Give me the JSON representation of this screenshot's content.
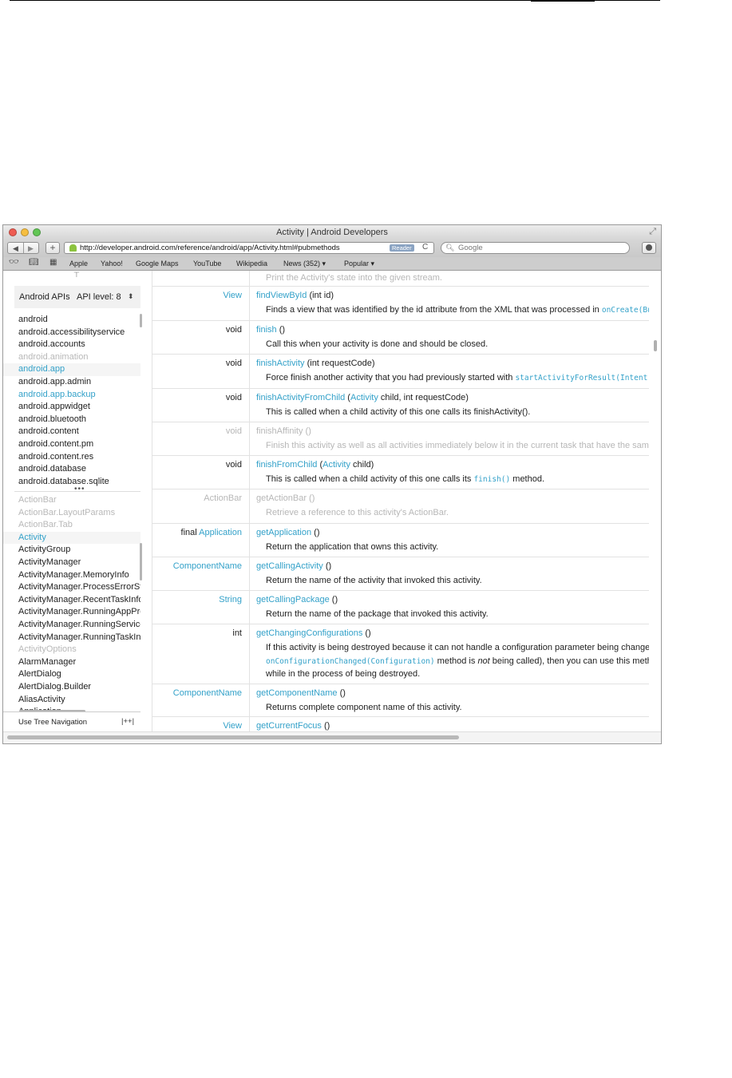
{
  "window": {
    "title": "Activity | Android Developers"
  },
  "toolbar": {
    "back_icon": "back-arrow-icon",
    "forward_icon": "forward-arrow-icon",
    "add_label": "+",
    "url": "http://developer.android.com/reference/android/app/Activity.html#pubmethods",
    "reader_label": "Reader",
    "reload_glyph": "C",
    "search_placeholder": "Google"
  },
  "bookmarks": [
    "Apple",
    "Yahoo!",
    "Google Maps",
    "YouTube",
    "Wikipedia",
    "News (352) ▾",
    "Popular ▾"
  ],
  "sidebar": {
    "api_title": "Android APIs",
    "api_level": "API level: 8",
    "api_arrows": "⬍",
    "packages": [
      {
        "name": "android",
        "state": "normal"
      },
      {
        "name": "android.accessibilityservice",
        "state": "normal"
      },
      {
        "name": "android.accounts",
        "state": "normal"
      },
      {
        "name": "android.animation",
        "state": "dim"
      },
      {
        "name": "android.app",
        "state": "selected"
      },
      {
        "name": "android.app.admin",
        "state": "normal"
      },
      {
        "name": "android.app.backup",
        "state": "link"
      },
      {
        "name": "android.appwidget",
        "state": "normal"
      },
      {
        "name": "android.bluetooth",
        "state": "normal"
      },
      {
        "name": "android.content",
        "state": "normal"
      },
      {
        "name": "android.content.pm",
        "state": "normal"
      },
      {
        "name": "android.content.res",
        "state": "normal"
      },
      {
        "name": "android.database",
        "state": "normal"
      },
      {
        "name": "android.database.sqlite",
        "state": "normal"
      }
    ],
    "classes": [
      {
        "name": "ActionBar",
        "state": "dim"
      },
      {
        "name": "ActionBar.LayoutParams",
        "state": "dim"
      },
      {
        "name": "ActionBar.Tab",
        "state": "dim"
      },
      {
        "name": "Activity",
        "state": "selected"
      },
      {
        "name": "ActivityGroup",
        "state": "normal"
      },
      {
        "name": "ActivityManager",
        "state": "normal"
      },
      {
        "name": "ActivityManager.MemoryInfo",
        "state": "normal"
      },
      {
        "name": "ActivityManager.ProcessErrorStateInfo",
        "state": "normal"
      },
      {
        "name": "ActivityManager.RecentTaskInfo",
        "state": "normal"
      },
      {
        "name": "ActivityManager.RunningAppProcessInfo",
        "state": "normal"
      },
      {
        "name": "ActivityManager.RunningServiceInfo",
        "state": "normal"
      },
      {
        "name": "ActivityManager.RunningTaskInfo",
        "state": "normal"
      },
      {
        "name": "ActivityOptions",
        "state": "dim"
      },
      {
        "name": "AlarmManager",
        "state": "normal"
      },
      {
        "name": "AlertDialog",
        "state": "normal"
      },
      {
        "name": "AlertDialog.Builder",
        "state": "normal"
      },
      {
        "name": "AliasActivity",
        "state": "normal"
      },
      {
        "name": "Application",
        "state": "normal"
      }
    ],
    "tree_nav_label": "Use Tree Navigation",
    "tree_nav_toggle": "|++|"
  },
  "methods": [
    {
      "dim": true,
      "ret": [],
      "sig": [],
      "desc": [
        [
          {
            "t": "Print the Activity's state into the given stream."
          }
        ]
      ]
    },
    {
      "dim": false,
      "ret": [
        {
          "t": "View",
          "c": "lnk"
        }
      ],
      "sig": [
        {
          "t": "findViewById",
          "c": "lnk"
        },
        {
          "t": " (int id)"
        }
      ],
      "desc": [
        [
          {
            "t": "Finds a view that was identified by the id attribute from the XML that was processed in "
          },
          {
            "t": "onCreate(Bundle)",
            "c": "code"
          }
        ]
      ]
    },
    {
      "dim": false,
      "ret": [
        {
          "t": "void"
        }
      ],
      "sig": [
        {
          "t": "finish",
          "c": "lnk"
        },
        {
          "t": " ()"
        }
      ],
      "desc": [
        [
          {
            "t": "Call this when your activity is done and should be closed."
          }
        ]
      ]
    },
    {
      "dim": false,
      "ret": [
        {
          "t": "void"
        }
      ],
      "sig": [
        {
          "t": "finishActivity",
          "c": "lnk"
        },
        {
          "t": " (int requestCode)"
        }
      ],
      "desc": [
        [
          {
            "t": "Force finish another activity that you had previously started with "
          },
          {
            "t": "startActivityForResult(Intent, int)",
            "c": "code"
          }
        ]
      ]
    },
    {
      "dim": false,
      "ret": [
        {
          "t": "void"
        }
      ],
      "sig": [
        {
          "t": "finishActivityFromChild",
          "c": "lnk"
        },
        {
          "t": " ("
        },
        {
          "t": "Activity",
          "c": "lnk"
        },
        {
          "t": " child, int requestCode)"
        }
      ],
      "desc": [
        [
          {
            "t": "This is called when a child activity of this one calls its finishActivity()."
          }
        ]
      ]
    },
    {
      "dim": true,
      "ret": [
        {
          "t": "void"
        }
      ],
      "sig": [
        {
          "t": "finishAffinity",
          "c": "lnk"
        },
        {
          "t": " ()"
        }
      ],
      "desc": [
        [
          {
            "t": "Finish this activity as well as all activities immediately below it in the current task that have the same affinity."
          }
        ]
      ]
    },
    {
      "dim": false,
      "ret": [
        {
          "t": "void"
        }
      ],
      "sig": [
        {
          "t": "finishFromChild",
          "c": "lnk"
        },
        {
          "t": " ("
        },
        {
          "t": "Activity",
          "c": "lnk"
        },
        {
          "t": " child)"
        }
      ],
      "desc": [
        [
          {
            "t": "This is called when a child activity of this one calls its "
          },
          {
            "t": "finish()",
            "c": "code"
          },
          {
            "t": " method."
          }
        ]
      ]
    },
    {
      "dim": true,
      "ret": [
        {
          "t": "ActionBar",
          "c": "lnk"
        }
      ],
      "sig": [
        {
          "t": "getActionBar",
          "c": "lnk"
        },
        {
          "t": " ()"
        }
      ],
      "desc": [
        [
          {
            "t": "Retrieve a reference to this activity's ActionBar."
          }
        ]
      ]
    },
    {
      "dim": false,
      "ret": [
        {
          "t": "final "
        },
        {
          "t": "Application",
          "c": "lnk"
        }
      ],
      "sig": [
        {
          "t": "getApplication",
          "c": "lnk"
        },
        {
          "t": " ()"
        }
      ],
      "desc": [
        [
          {
            "t": "Return the application that owns this activity."
          }
        ]
      ]
    },
    {
      "dim": false,
      "ret": [
        {
          "t": "ComponentName",
          "c": "lnk"
        }
      ],
      "sig": [
        {
          "t": "getCallingActivity",
          "c": "lnk"
        },
        {
          "t": " ()"
        }
      ],
      "desc": [
        [
          {
            "t": "Return the name of the activity that invoked this activity."
          }
        ]
      ]
    },
    {
      "dim": false,
      "ret": [
        {
          "t": "String",
          "c": "lnk"
        }
      ],
      "sig": [
        {
          "t": "getCallingPackage",
          "c": "lnk"
        },
        {
          "t": " ()"
        }
      ],
      "desc": [
        [
          {
            "t": "Return the name of the package that invoked this activity."
          }
        ]
      ]
    },
    {
      "dim": false,
      "ret": [
        {
          "t": "int"
        }
      ],
      "sig": [
        {
          "t": "getChangingConfigurations",
          "c": "lnk"
        },
        {
          "t": " ()"
        }
      ],
      "desc": [
        [
          {
            "t": "If this activity is being destroyed because it can not handle a configuration parameter being changed (and thus its"
          }
        ],
        [
          {
            "t": "onConfigurationChanged(Configuration)",
            "c": "code"
          },
          {
            "t": " method is "
          },
          {
            "t": "not",
            "c": "em"
          },
          {
            "t": " being called), then you can use this method to discover the set of changes that have occurred"
          }
        ],
        [
          {
            "t": "while in the process of being destroyed."
          }
        ]
      ]
    },
    {
      "dim": false,
      "ret": [
        {
          "t": "ComponentName",
          "c": "lnk"
        }
      ],
      "sig": [
        {
          "t": "getComponentName",
          "c": "lnk"
        },
        {
          "t": " ()"
        }
      ],
      "desc": [
        [
          {
            "t": "Returns complete component name of this activity."
          }
        ]
      ]
    },
    {
      "dim": false,
      "ret": [
        {
          "t": "View",
          "c": "lnk"
        }
      ],
      "sig": [
        {
          "t": "getCurrentFocus",
          "c": "lnk"
        },
        {
          "t": " ()"
        }
      ],
      "desc": []
    }
  ],
  "colors": {
    "link": "#33a1c9",
    "dim_text": "#b7b7b7",
    "selected_bg": "#f5f5f5"
  }
}
